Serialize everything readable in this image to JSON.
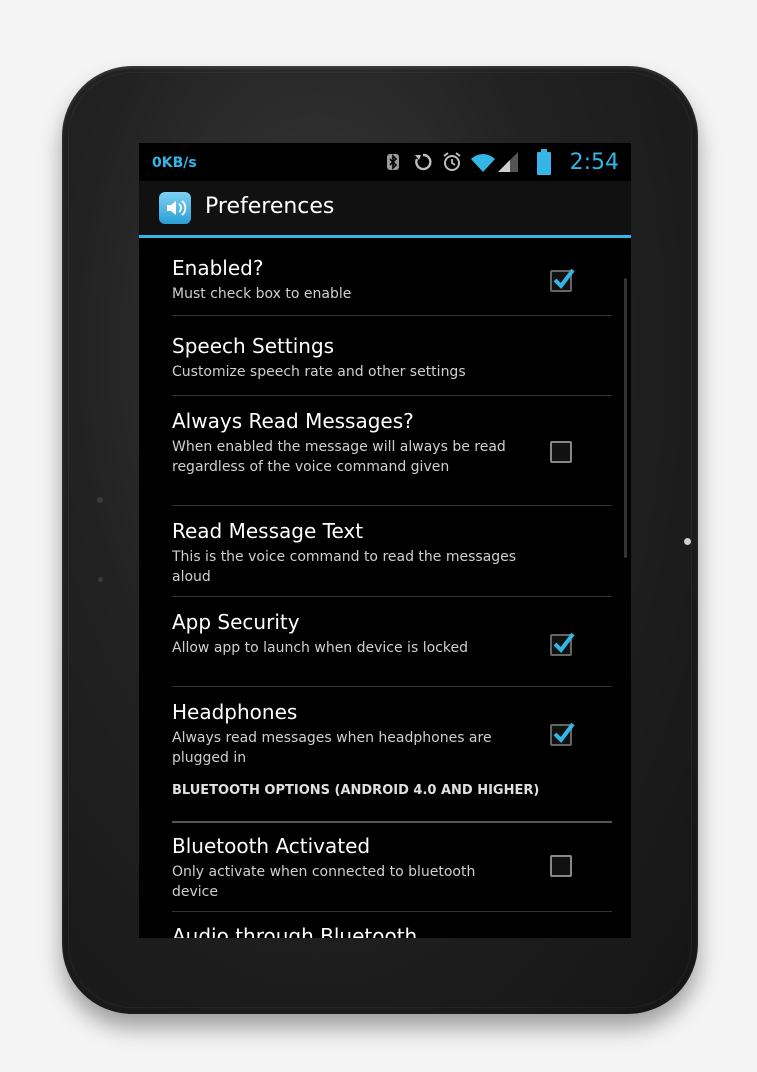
{
  "status_bar": {
    "net_speed": "0KB/s",
    "time": "2:54",
    "icons": [
      "bluetooth-icon",
      "sync-icon",
      "alarm-icon",
      "wifi-icon",
      "signal-icon",
      "battery-icon"
    ]
  },
  "action_bar": {
    "title": "Preferences",
    "app_icon": "speaker-icon"
  },
  "preferences": [
    {
      "title": "Enabled?",
      "summary": "Must check box to enable",
      "checked": true
    },
    {
      "title": "Speech Settings",
      "summary": "Customize speech rate and other settings"
    },
    {
      "title": "Always Read Messages?",
      "summary": "When enabled the message will always be read regardless of the voice command given",
      "checked": false
    },
    {
      "title": "Read Message Text",
      "summary": "This is the voice command to read the messages aloud"
    },
    {
      "title": "App Security",
      "summary": "Allow app to launch when device is locked",
      "checked": true
    },
    {
      "title": "Headphones",
      "summary": "Always read messages when headphones are plugged in",
      "checked": true
    }
  ],
  "category": "BLUETOOTH OPTIONS (ANDROID 4.0 AND HIGHER)",
  "bluetooth_preferences": [
    {
      "title": "Bluetooth Activated",
      "summary": "Only activate when connected to bluetooth device",
      "checked": false
    },
    {
      "title": "Audio through Bluetooth"
    }
  ],
  "colors": {
    "accent": "#33b5e5",
    "screen_bg": "#000000",
    "divider": "#333333"
  }
}
